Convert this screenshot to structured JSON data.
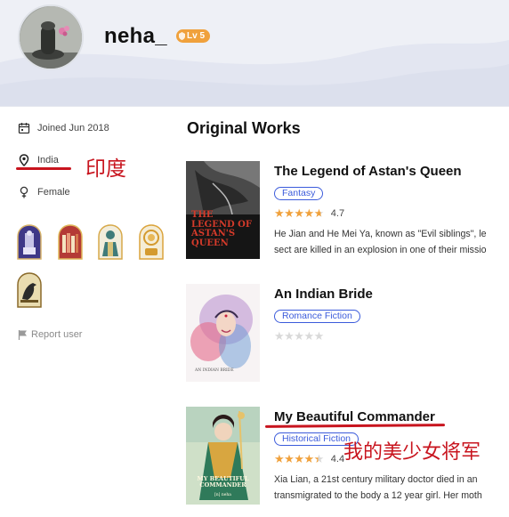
{
  "profile": {
    "username": "neha_",
    "level": "Lv 5"
  },
  "sidebar": {
    "joined": "Joined Jun 2018",
    "location": "India",
    "gender": "Female",
    "report": "Report user",
    "badges": [
      {
        "icon": "knight-badge-icon",
        "color": "#4a3f8f"
      },
      {
        "icon": "bookshelf-badge-icon",
        "color": "#b83a3a"
      },
      {
        "icon": "scholar-badge-icon",
        "color": "#3d7b7a"
      },
      {
        "icon": "scroll-badge-icon",
        "color": "#d9a13a"
      },
      {
        "icon": "raven-badge-icon",
        "color": "#8a6a2a"
      }
    ]
  },
  "works": {
    "heading": "Original Works",
    "items": [
      {
        "title": "The Legend of Astan's Queen",
        "genre": "Fantasy",
        "rating": 4.7,
        "rating_text": "4.7",
        "stars": "★★★★★",
        "description": [
          "He Jian and He Mei Ya, known as \"Evil siblings\", le",
          "sect are killed in an explosion in one of their missio"
        ],
        "cover_text": "THE LEGEND OF ASTAN'S QUEEN"
      },
      {
        "title": "An Indian Bride",
        "genre": "Romance Fiction",
        "rating": 0,
        "rating_text": "",
        "stars": "★★★★★",
        "description": [
          "",
          ""
        ],
        "cover_text": "AN INDIAN BRIDE"
      },
      {
        "title": "My Beautiful Commander",
        "genre": "Historical Fiction",
        "rating": 4.4,
        "rating_text": "4.4",
        "stars": "★★★★★",
        "description": [
          "Xia Lian, a 21st century military doctor died in an",
          "transmigrated to the body a 12 year girl. Her moth"
        ],
        "cover_text": "MY BEAUTIFUL COMMANDER",
        "cover_author": "[n] neha"
      }
    ]
  },
  "annotations": {
    "india_cn": "印度",
    "commander_cn": "我的美少女将军"
  },
  "colors": {
    "accent_blue": "#3b5bdb",
    "star_orange": "#f0a13c",
    "annotation_red": "#c8141e"
  }
}
